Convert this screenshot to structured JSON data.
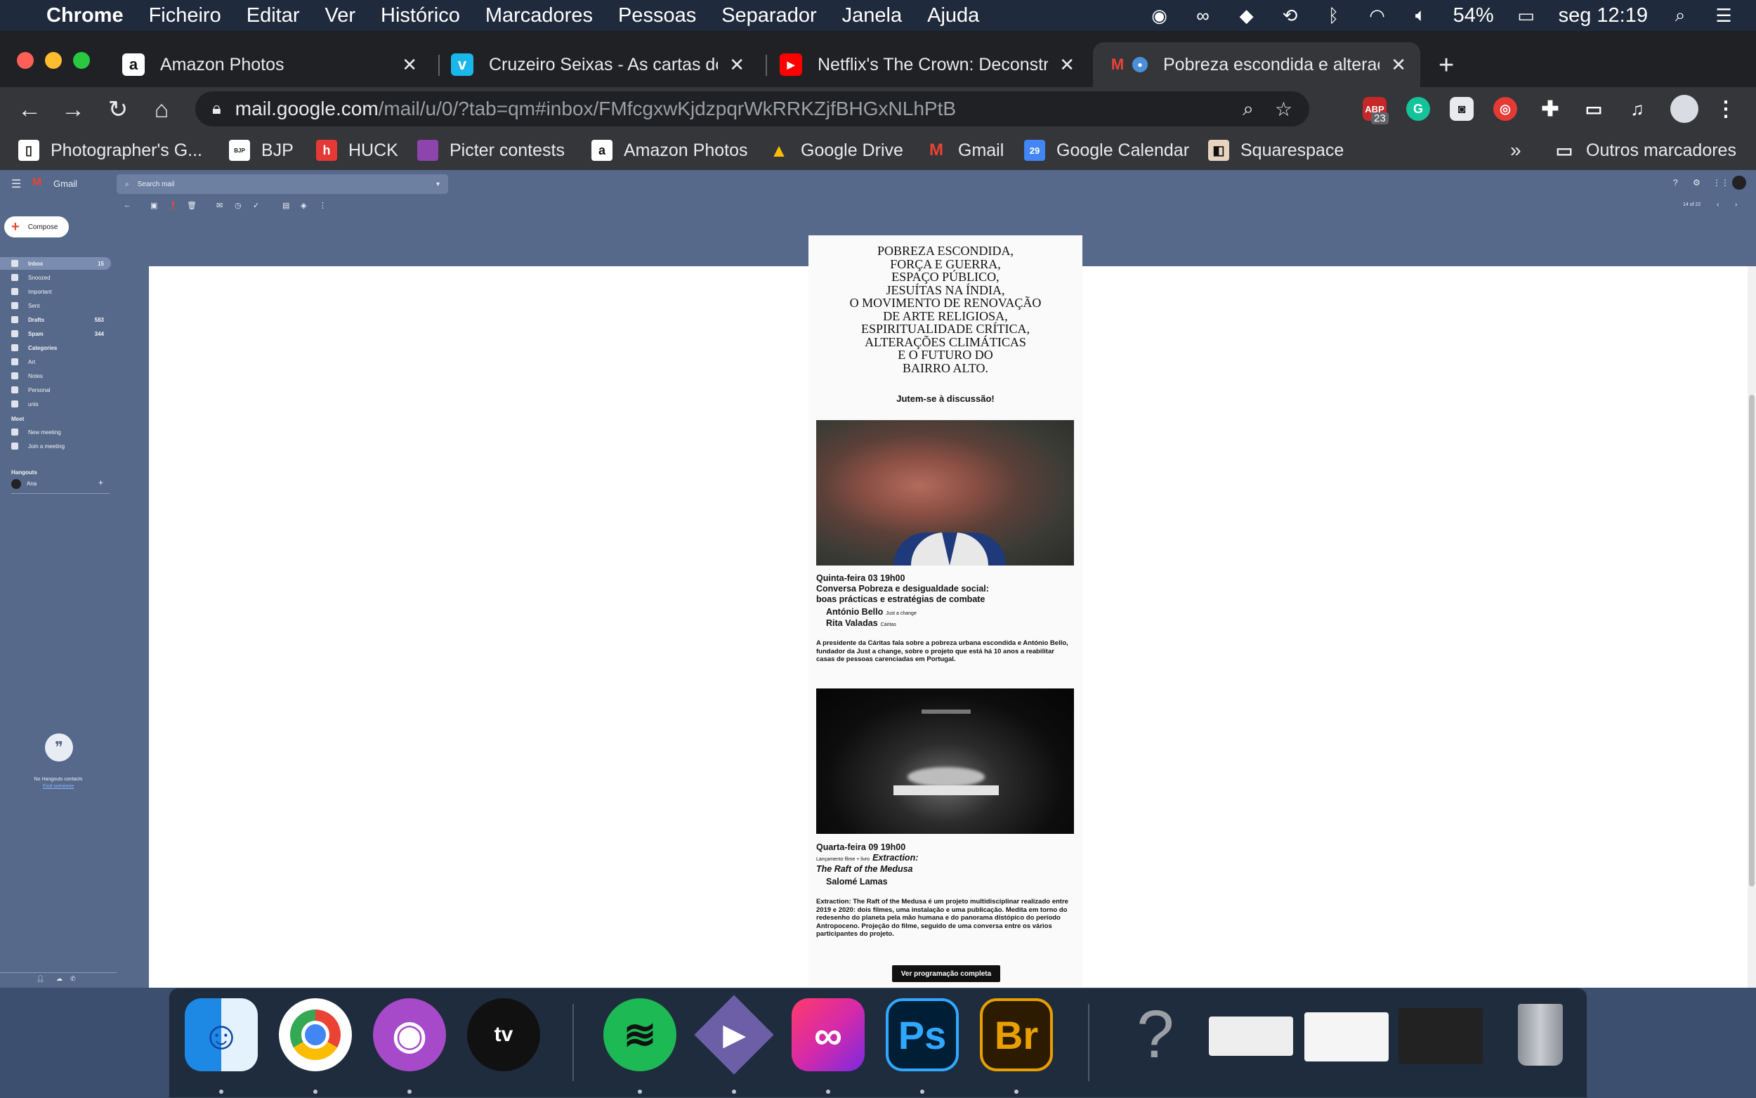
{
  "menubar": {
    "app": "Chrome",
    "items": [
      "Ficheiro",
      "Editar",
      "Ver",
      "Histórico",
      "Marcadores",
      "Pessoas",
      "Separador",
      "Janela",
      "Ajuda"
    ],
    "battery": "54%",
    "clock": "seg 12:19"
  },
  "tabs": [
    {
      "title": "Amazon Photos"
    },
    {
      "title": "Cruzeiro Seixas - As cartas do"
    },
    {
      "title": "Netflix's The Crown: Deconstru"
    },
    {
      "title": "Pobreza escondida e alterac"
    }
  ],
  "omnibox": {
    "host": "mail.google.com",
    "path": "/mail/u/0/?tab=qm#inbox/FMfcgxwKjdzpqrWkRRKZjfBHGxNLhPtB"
  },
  "extensions": {
    "abp_badge": "23"
  },
  "bookmarks": [
    {
      "label": "Photographer's G..."
    },
    {
      "label": "BJP"
    },
    {
      "label": "HUCK"
    },
    {
      "label": "Picter contests"
    },
    {
      "label": "Amazon Photos"
    },
    {
      "label": "Google Drive"
    },
    {
      "label": "Gmail"
    },
    {
      "label": "Google Calendar"
    },
    {
      "label": "Squarespace"
    }
  ],
  "bookmarks_more": "»",
  "other_bookmarks": "Outros marcadores",
  "gmail": {
    "logo": "Gmail",
    "search_placeholder": "Search mail",
    "compose": "Compose",
    "nav": [
      {
        "label": "Inbox",
        "count": "15",
        "active": true
      },
      {
        "label": "Snoozed",
        "count": ""
      },
      {
        "label": "Important",
        "count": ""
      },
      {
        "label": "Sent",
        "count": ""
      },
      {
        "label": "Drafts",
        "count": "583"
      },
      {
        "label": "Spam",
        "count": "344"
      },
      {
        "label": "Categories",
        "count": ""
      },
      {
        "label": "Art",
        "count": ""
      },
      {
        "label": "Notes",
        "count": ""
      },
      {
        "label": "Personal",
        "count": ""
      },
      {
        "label": "unis",
        "count": ""
      }
    ],
    "meet_label": "Meet",
    "meet_items": [
      "New meeting",
      "Join a meeting"
    ],
    "hangouts_label": "Hangouts",
    "hangouts_user": "Ana",
    "hangouts_empty": "No Hangouts contacts",
    "hangouts_find": "Find someone",
    "pager": "14 of 22"
  },
  "email": {
    "poster_lines": [
      "POBREZA ESCONDIDA,",
      "FORÇA E GUERRA,",
      "ESPAÇO PÚBLICO,",
      "JESUÍTAS NA ÍNDIA,",
      "O MOVIMENTO DE RENOVAÇÃO",
      "DE ARTE RELIGIOSA,",
      "ESPIRITUALIDADE CRÍTICA,",
      "ALTERAÇÕES CLIMÁTICAS",
      "E O FUTURO DO",
      "BAIRRO ALTO."
    ],
    "headline": "Jutem-se à discussão!",
    "event1": {
      "date": "Quinta-feira 03  19h00",
      "title1": "Conversa Pobreza e desigualdade social:",
      "title2": "boas prácticas e estratégias de combate",
      "person1": "António Bello",
      "person1_org": "Just a change",
      "person2": "Rita Valadas",
      "person2_org": "Cáritas",
      "desc": "A presidente da Cáritas fala sobre a pobreza urbana escondida e António Bello, fundador da Just a change, sobre o projeto que está há 10 anos a reabilitar casas de pessoas carenciadas em Portugal."
    },
    "event2": {
      "date": "Quarta-feira 09  19h00",
      "small": "Lançamento filme + livro",
      "title1": "Extraction:",
      "title2": "The Raft of the Medusa",
      "person1": "Salomé Lamas",
      "desc": "Extraction: The Raft of the Medusa é um projeto multidisciplinar realizado entre 2019 e 2020: dois filmes, uma instalação e uma publicação. Medita em torno do redesenho do planeta pela mão humana e do panorama distópico do período Antropoceno. Projeção do filme, seguido de uma conversa entre os vários participantes do projeto."
    },
    "cta": "Ver programação completa"
  }
}
